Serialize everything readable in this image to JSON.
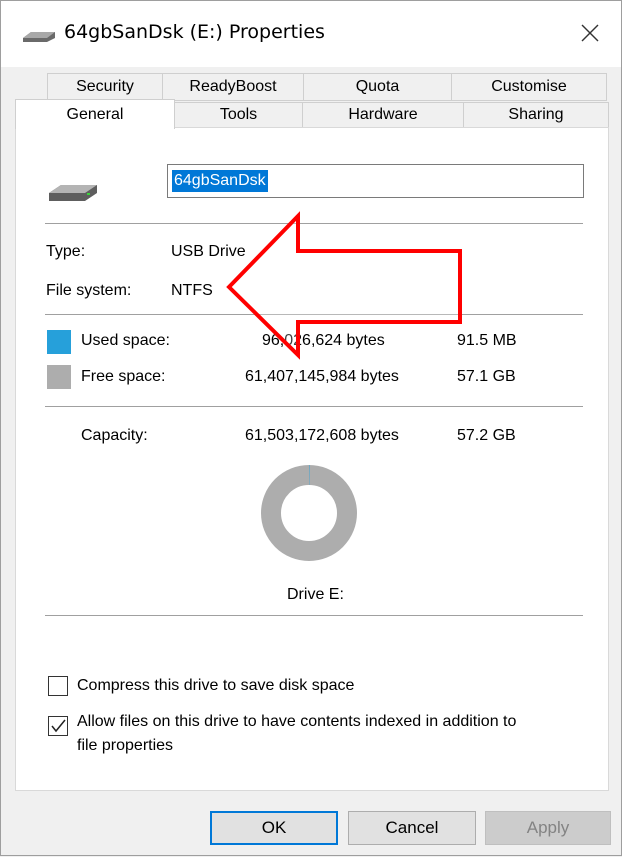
{
  "window": {
    "title": "64gbSanDsk (E:) Properties"
  },
  "tabs": {
    "row1": [
      "Security",
      "ReadyBoost",
      "Quota",
      "Customise"
    ],
    "row2": [
      "General",
      "Tools",
      "Hardware",
      "Sharing"
    ],
    "active": "General"
  },
  "general": {
    "drive_name": "64gbSanDsk",
    "type_label": "Type:",
    "type_value": "USB Drive",
    "fs_label": "File system:",
    "fs_value": "NTFS",
    "used": {
      "label": "Used space:",
      "bytes": "96,026,624 bytes",
      "size": "91.5 MB",
      "color": "#26a0da"
    },
    "free": {
      "label": "Free space:",
      "bytes": "61,407,145,984 bytes",
      "size": "57.1 GB",
      "color": "#adadad"
    },
    "capacity": {
      "label": "Capacity:",
      "bytes": "61,503,172,608 bytes",
      "size": "57.2 GB"
    },
    "drive_caption": "Drive E:",
    "used_fraction": 0.0016
  },
  "options": {
    "compress": {
      "label": "Compress this drive to save disk space",
      "checked": false
    },
    "index_line1": "Allow files on this drive to have contents indexed in addition to",
    "index_line2": "file properties",
    "index_checked": true
  },
  "buttons": {
    "ok": "OK",
    "cancel": "Cancel",
    "apply": "Apply"
  }
}
